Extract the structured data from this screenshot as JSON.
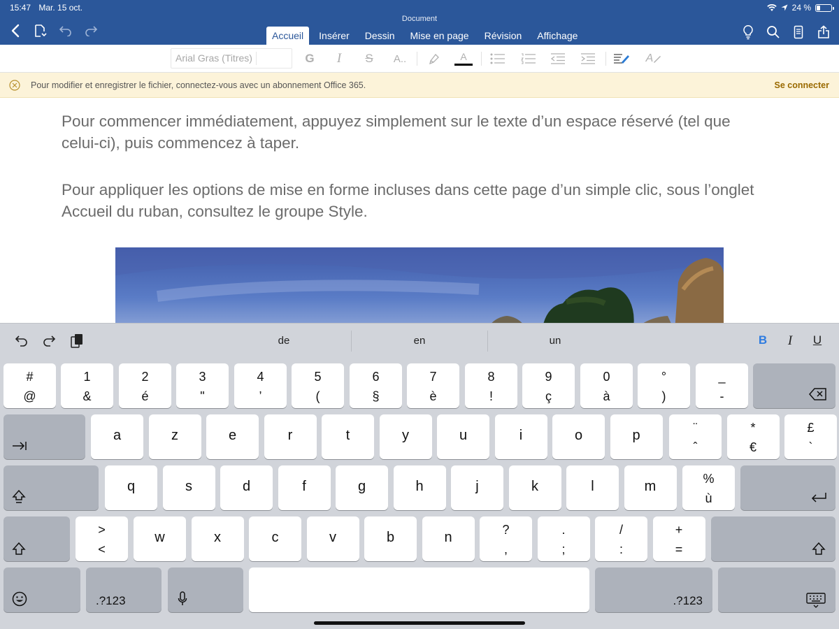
{
  "status": {
    "time": "15:47",
    "date": "Mar. 15 oct.",
    "battery": "24 %",
    "battery_level": 0.24
  },
  "app": {
    "doc_title": "Document"
  },
  "ribbon": {
    "tabs": [
      {
        "label": "Accueil",
        "active": true
      },
      {
        "label": "Insérer"
      },
      {
        "label": "Dessin"
      },
      {
        "label": "Mise en page"
      },
      {
        "label": "Révision"
      },
      {
        "label": "Affichage"
      }
    ]
  },
  "toolbar": {
    "font_placeholder": "Arial Gras (Titres)",
    "bold": "G",
    "italic": "I",
    "strike": "S",
    "font_size": "A..",
    "font_color": "A",
    "styles": "A"
  },
  "notice": {
    "text": "Pour modifier et enregistrer le fichier, connectez-vous avec un abonnement Office 365.",
    "link": "Se connecter"
  },
  "document": {
    "paragraphs": [
      "Pour commencer immédiatement, appuyez simplement sur le texte d’un espace réservé (tel que celui-ci), puis commencez à taper.",
      "Pour appliquer les options de mise en forme incluses dans cette page d’un simple clic, sous l’onglet Accueil du ruban, consultez le groupe Style."
    ]
  },
  "keyboard": {
    "suggestions": [
      "de",
      "en",
      "un"
    ],
    "format": {
      "bold": "B",
      "italic": "I",
      "underline": "U"
    },
    "row1": [
      {
        "top": "#",
        "bot": "@"
      },
      {
        "top": "1",
        "bot": "&"
      },
      {
        "top": "2",
        "bot": "é"
      },
      {
        "top": "3",
        "bot": "\""
      },
      {
        "top": "4",
        "bot": "’"
      },
      {
        "top": "5",
        "bot": "("
      },
      {
        "top": "6",
        "bot": "§"
      },
      {
        "top": "7",
        "bot": "è"
      },
      {
        "top": "8",
        "bot": "!"
      },
      {
        "top": "9",
        "bot": "ç"
      },
      {
        "top": "0",
        "bot": "à"
      },
      {
        "top": "°",
        "bot": ")"
      },
      {
        "top": "_",
        "bot": "-"
      }
    ],
    "row2": [
      "a",
      "z",
      "e",
      "r",
      "t",
      "y",
      "u",
      "i",
      "o",
      "p"
    ],
    "row2_extra": [
      {
        "top": "¨",
        "bot": "ˆ"
      },
      {
        "top": "*",
        "bot": "€"
      },
      {
        "top": "£",
        "bot": "`"
      }
    ],
    "row3": [
      "q",
      "s",
      "d",
      "f",
      "g",
      "h",
      "j",
      "k",
      "l",
      "m"
    ],
    "row3_extra": {
      "top": "%",
      "bot": "ù"
    },
    "row4": [
      "w",
      "x",
      "c",
      "v",
      "b",
      "n"
    ],
    "row4_pairs": [
      {
        "top": ">",
        "bot": "<"
      },
      {
        "top": "?",
        "bot": ","
      },
      {
        "top": ".",
        "bot": ";"
      },
      {
        "top": "/",
        "bot": ":"
      },
      {
        "top": "+",
        "bot": "="
      }
    ],
    "numbers_label": ".?123"
  },
  "colors": {
    "brand": "#2b579a",
    "notice_bg": "#fcf3d9",
    "notice_link": "#9a6a00",
    "bold_accent": "#2f7ce0"
  }
}
